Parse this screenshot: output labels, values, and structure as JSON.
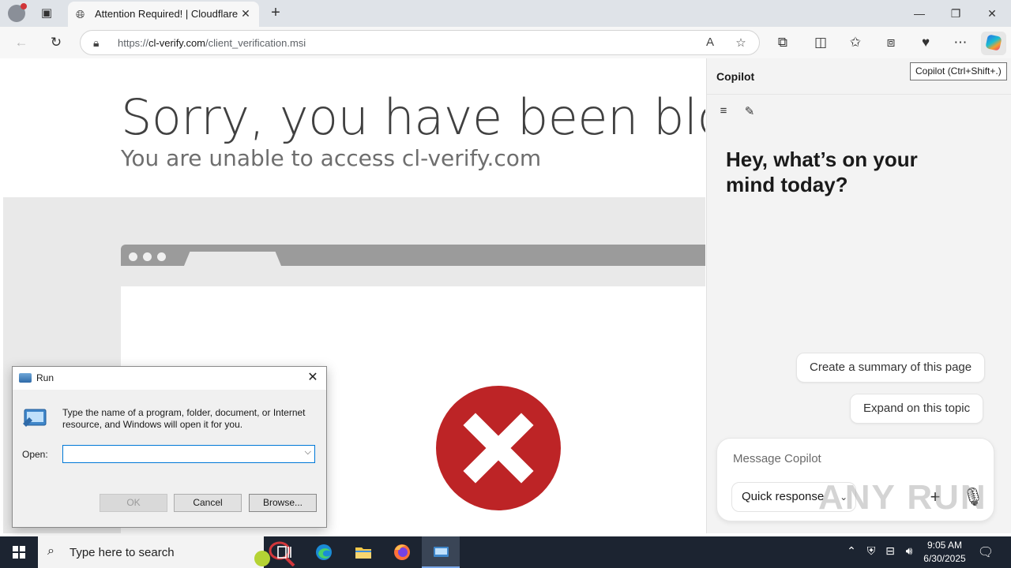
{
  "browser": {
    "tab_title": "Attention Required! | Cloudflare",
    "url_prefix": "https://",
    "url_domain": "cl-verify.com",
    "url_path": "/client_verification.msi",
    "tooltip": "Copilot (Ctrl+Shift+.)"
  },
  "page": {
    "heading": "Sorry, you have been blocked",
    "subheading": "You are unable to access cl-verify.com",
    "error_color": "#bd2426"
  },
  "copilot": {
    "header": "Copilot",
    "greeting": "Hey, what’s on your mind today?",
    "suggestions": [
      "Create a summary of this page",
      "Expand on this topic"
    ],
    "input_placeholder": "Message Copilot",
    "mode_label": "Quick response"
  },
  "run_dialog": {
    "title": "Run",
    "description": "Type the name of a program, folder, document, or Internet resource, and Windows will open it for you.",
    "open_label": "Open:",
    "open_value": "",
    "ok_label": "OK",
    "cancel_label": "Cancel",
    "browse_label": "Browse..."
  },
  "taskbar": {
    "search_placeholder": "Type here to search",
    "time": "9:05 AM",
    "date": "6/30/2025"
  },
  "watermark": "ANY RUN"
}
